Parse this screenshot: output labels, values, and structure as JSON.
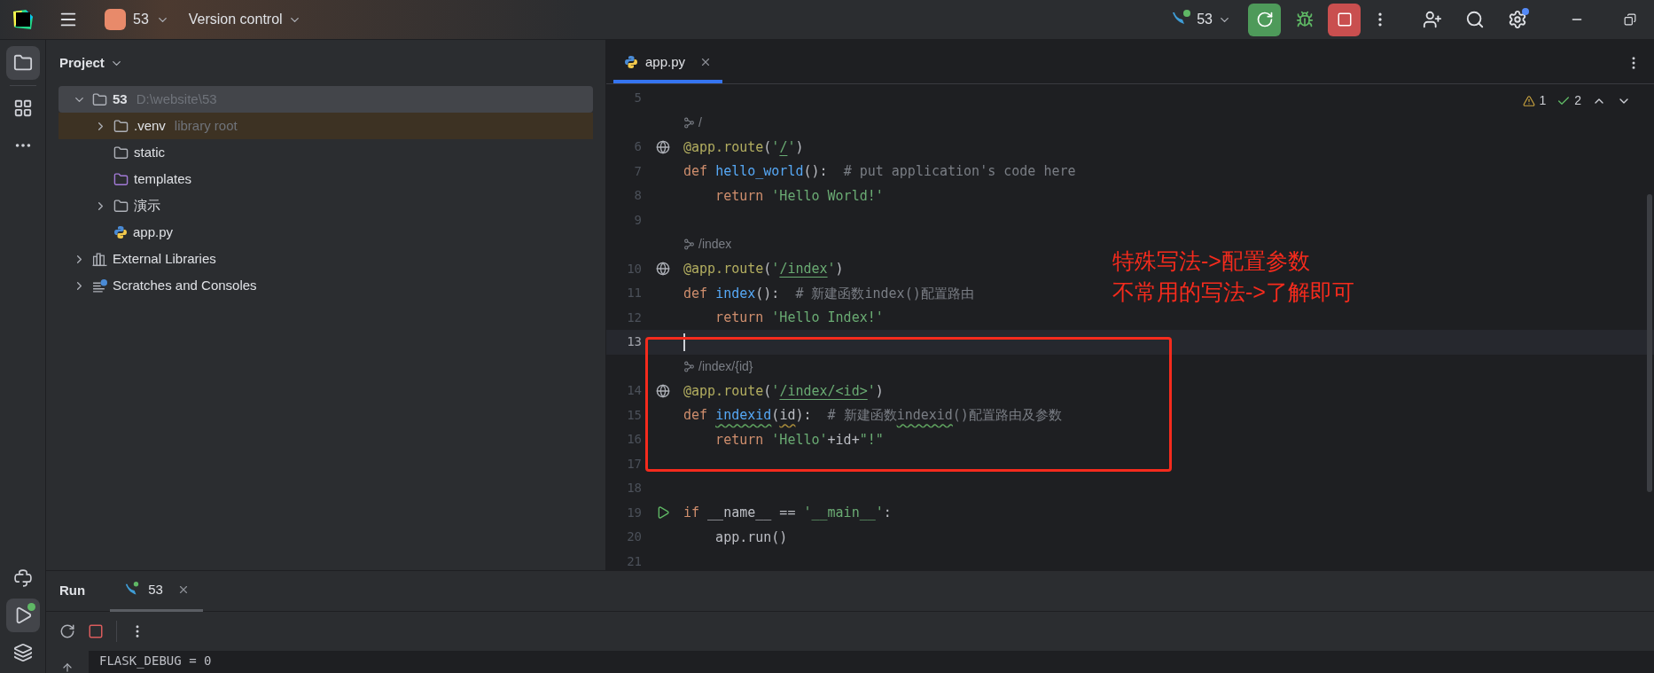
{
  "title_bar": {
    "project": "53",
    "vcs": "Version control",
    "run_config": "53",
    "settings_badge": true
  },
  "left_strip": {
    "top": [
      {
        "kind": "project",
        "selected": true
      },
      {
        "kind": "structure",
        "selected": false
      },
      {
        "kind": "more",
        "selected": false
      }
    ],
    "bottom": [
      {
        "kind": "python",
        "selected": false
      },
      {
        "kind": "run",
        "selected": true
      },
      {
        "kind": "layers",
        "selected": false
      }
    ]
  },
  "project_panel": {
    "title": "Project",
    "tree": [
      {
        "label": "53",
        "detail": "D:\\website\\53",
        "kind": "folder",
        "expanded": true,
        "selected": true,
        "highlighted": false,
        "children": [
          {
            "label": ".venv",
            "detail": "library root",
            "kind": "folder",
            "expanded": false,
            "selected": false,
            "highlighted": true
          },
          {
            "label": "static",
            "kind": "folder",
            "selected": false,
            "highlighted": false
          },
          {
            "label": "templates",
            "kind": "template_folder",
            "selected": false,
            "highlighted": false
          },
          {
            "label": "演示",
            "kind": "folder",
            "expanded": false,
            "selected": false,
            "highlighted": false
          },
          {
            "label": "app.py",
            "kind": "python_file",
            "selected": false,
            "highlighted": false
          }
        ]
      },
      {
        "label": "External Libraries",
        "kind": "libraries",
        "expanded": false,
        "selected": false,
        "highlighted": false
      },
      {
        "label": "Scratches and Consoles",
        "kind": "scratches",
        "expanded": false,
        "selected": false,
        "highlighted": false
      }
    ]
  },
  "editor": {
    "tabs": [
      {
        "label": "app.py",
        "selected": true
      }
    ],
    "inspections": {
      "warnings": "1",
      "checks": "2"
    },
    "rows": [
      {
        "kind": "code",
        "number": "5",
        "current": false,
        "tokens": []
      },
      {
        "kind": "hint",
        "text": "/"
      },
      {
        "kind": "code",
        "number": "6",
        "gutter": {
          "kind": "route"
        },
        "current": false,
        "tokens": [
          {
            "kind": "decorator",
            "text": "@app.route"
          },
          {
            "kind": "plain",
            "text": "("
          },
          {
            "kind": "string",
            "text": "'"
          },
          {
            "kind": "url",
            "text": "/"
          },
          {
            "kind": "string",
            "text": "'"
          },
          {
            "kind": "plain",
            "text": ")"
          }
        ]
      },
      {
        "kind": "code",
        "number": "7",
        "current": false,
        "tokens": [
          {
            "kind": "keyword",
            "text": "def "
          },
          {
            "kind": "function",
            "text": "hello_world"
          },
          {
            "kind": "plain",
            "text": "():  "
          },
          {
            "kind": "comment",
            "text": "# put application's code here"
          }
        ]
      },
      {
        "kind": "code",
        "number": "8",
        "current": false,
        "tokens": [
          {
            "kind": "keyword",
            "text": "    return "
          },
          {
            "kind": "string",
            "text": "'Hello World!'"
          }
        ]
      },
      {
        "kind": "code",
        "number": "9",
        "current": false,
        "tokens": []
      },
      {
        "kind": "hint",
        "text": "/index"
      },
      {
        "kind": "code",
        "number": "10",
        "gutter": {
          "kind": "route"
        },
        "current": false,
        "tokens": [
          {
            "kind": "decorator",
            "text": "@app.route"
          },
          {
            "kind": "plain",
            "text": "("
          },
          {
            "kind": "string",
            "text": "'"
          },
          {
            "kind": "url",
            "text": "/index"
          },
          {
            "kind": "string",
            "text": "'"
          },
          {
            "kind": "plain",
            "text": ")"
          }
        ]
      },
      {
        "kind": "code",
        "number": "11",
        "current": false,
        "tokens": [
          {
            "kind": "keyword",
            "text": "def "
          },
          {
            "kind": "function",
            "text": "index"
          },
          {
            "kind": "plain",
            "text": "():  "
          },
          {
            "kind": "comment",
            "text": "# 新建函数index()配置路由"
          }
        ]
      },
      {
        "kind": "code",
        "number": "12",
        "current": false,
        "tokens": [
          {
            "kind": "keyword",
            "text": "    return "
          },
          {
            "kind": "string",
            "text": "'Hello Index!'"
          }
        ]
      },
      {
        "kind": "code",
        "number": "13",
        "current": true,
        "tokens": []
      },
      {
        "kind": "hint",
        "text": "/index/{id}"
      },
      {
        "kind": "code",
        "number": "14",
        "gutter": {
          "kind": "route"
        },
        "current": false,
        "tokens": [
          {
            "kind": "decorator",
            "text": "@app.route"
          },
          {
            "kind": "plain",
            "text": "("
          },
          {
            "kind": "string",
            "text": "'"
          },
          {
            "kind": "url",
            "text": "/index/<id>"
          },
          {
            "kind": "string",
            "text": "'"
          },
          {
            "kind": "plain",
            "text": ")"
          }
        ]
      },
      {
        "kind": "code",
        "number": "15",
        "current": false,
        "tokens": [
          {
            "kind": "keyword",
            "text": "def "
          },
          {
            "kind": "function",
            "text": "indexid",
            "squiggle": {
              "kind": "typo"
            }
          },
          {
            "kind": "plain",
            "text": "("
          },
          {
            "kind": "plain",
            "text": "id",
            "squiggle": {
              "kind": "weak"
            }
          },
          {
            "kind": "plain",
            "text": "):  "
          },
          {
            "kind": "comment",
            "text": "# 新建函数"
          },
          {
            "kind": "comment",
            "text": "indexid",
            "squiggle": {
              "kind": "typo"
            }
          },
          {
            "kind": "comment",
            "text": "()配置路由及参数"
          }
        ]
      },
      {
        "kind": "code",
        "number": "16",
        "current": false,
        "tokens": [
          {
            "kind": "keyword",
            "text": "    return "
          },
          {
            "kind": "string",
            "text": "'Hello'"
          },
          {
            "kind": "plain",
            "text": "+id+"
          },
          {
            "kind": "string",
            "text": "\"!\""
          }
        ]
      },
      {
        "kind": "code",
        "number": "17",
        "current": false,
        "tokens": []
      },
      {
        "kind": "code",
        "number": "18",
        "current": false,
        "tokens": []
      },
      {
        "kind": "code",
        "number": "19",
        "gutter": {
          "kind": "run"
        },
        "current": false,
        "tokens": [
          {
            "kind": "keyword",
            "text": "if "
          },
          {
            "kind": "plain",
            "text": "__name__ == "
          },
          {
            "kind": "string",
            "text": "'__main__'"
          },
          {
            "kind": "plain",
            "text": ":"
          }
        ]
      },
      {
        "kind": "code",
        "number": "20",
        "current": false,
        "tokens": [
          {
            "kind": "plain",
            "text": "    app.run()"
          }
        ]
      },
      {
        "kind": "code",
        "number": "21",
        "current": false,
        "tokens": []
      }
    ],
    "annotation": [
      "特殊写法->配置参数",
      "不常用的写法->了解即可"
    ]
  },
  "run_panel": {
    "title": "Run",
    "tabs": [
      {
        "label": "53",
        "selected": true
      }
    ],
    "console": [
      "FLASK_DEBUG = 0"
    ]
  }
}
